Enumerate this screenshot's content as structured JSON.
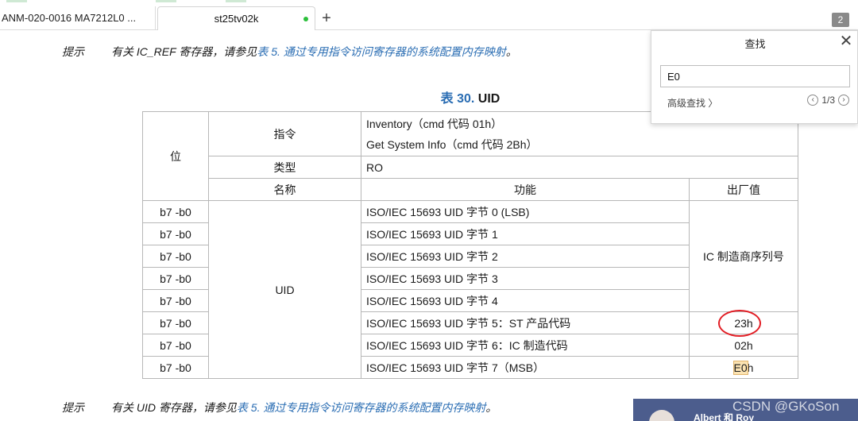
{
  "tabs": [
    {
      "label": "ANM-020-0016 MA7212L0 ..."
    },
    {
      "label": "st25tv02k"
    }
  ],
  "tab_count": "2",
  "doc": {
    "note1": {
      "label": "提示",
      "pre": "有关 IC_REF 寄存器，请参见",
      "link": "表 5. 通过专用指令访问寄存器的系统配置内存映射",
      "post": "。"
    },
    "caption": {
      "prefix": "表 30.",
      "name": "UID"
    },
    "table": {
      "bit_header": "位",
      "cmd_label": "指令",
      "cmd_values": [
        "Inventory（cmd 代码 01h）",
        "Get System Info（cmd 代码 2Bh）"
      ],
      "type_label": "类型",
      "type_value": "RO",
      "col_name": "名称",
      "col_func": "功能",
      "col_factory": "出厂值",
      "name_value": "UID",
      "factory_group": "IC 制造商序列号",
      "rows": [
        {
          "bit": "b7 -b0",
          "func": "ISO/IEC 15693 UID 字节 0 (LSB)"
        },
        {
          "bit": "b7 -b0",
          "func": "ISO/IEC 15693 UID 字节 1"
        },
        {
          "bit": "b7 -b0",
          "func": "ISO/IEC 15693 UID 字节 2"
        },
        {
          "bit": "b7 -b0",
          "func": "ISO/IEC 15693 UID 字节 3"
        },
        {
          "bit": "b7 -b0",
          "func": "ISO/IEC 15693 UID 字节 4"
        },
        {
          "bit": "b7 -b0",
          "func": "ISO/IEC 15693 UID 字节 5：ST 产品代码",
          "factory": "23h"
        },
        {
          "bit": "b7 -b0",
          "func": "ISO/IEC 15693 UID 字节 6：IC 制造代码",
          "factory": "02h"
        },
        {
          "bit": "b7 -b0",
          "func": "ISO/IEC 15693 UID 字节 7（MSB）",
          "factory_hl": "E0",
          "factory_rest": "h"
        }
      ]
    },
    "note2": {
      "label": "提示",
      "pre": "有关 UID 寄存器，请参见",
      "link": "表 5. 通过专用指令访问寄存器的系统配置内存映射",
      "post": "。"
    }
  },
  "find": {
    "title": "查找",
    "query": "E0",
    "advanced": "高级查找",
    "count": "1/3"
  },
  "popup_name": "Albert 和 Roy",
  "watermark": "CSDN @GKoSon",
  "colors": {
    "link": "#2a6db3",
    "highlight": "#fbe3b2",
    "circle": "#e21d24",
    "popup": "#4c5d8d"
  }
}
